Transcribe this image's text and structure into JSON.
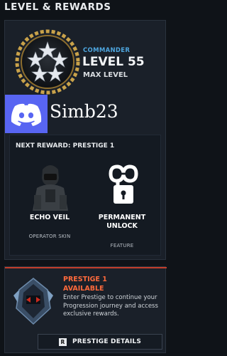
{
  "header": {
    "title": "LEVEL & REWARDS"
  },
  "rank": {
    "label": "COMMANDER",
    "level": "LEVEL 55",
    "status": "MAX LEVEL"
  },
  "overlay": {
    "username": "Simb23",
    "icon": "discord-icon"
  },
  "next_reward": {
    "title": "NEXT REWARD: PRESTIGE 1",
    "items": [
      {
        "name": "ECHO VEIL",
        "type": "OPERATOR SKIN",
        "icon": "operator-skin-image"
      },
      {
        "name": "PERMANENT UNLOCK",
        "type": "FEATURE",
        "icon": "infinity-lock-icon"
      }
    ]
  },
  "prestige": {
    "name": "PRESTIGE 1",
    "status": "AVAILABLE",
    "description": "Enter Prestige to continue your Progression journey and access exclusive rewards.",
    "button_key": "R",
    "button_label": "PRESTIGE DETAILS"
  },
  "colors": {
    "accent_blue": "#4ea6df",
    "prestige_orange": "#ff6a3c",
    "discord": "#5865f2"
  }
}
